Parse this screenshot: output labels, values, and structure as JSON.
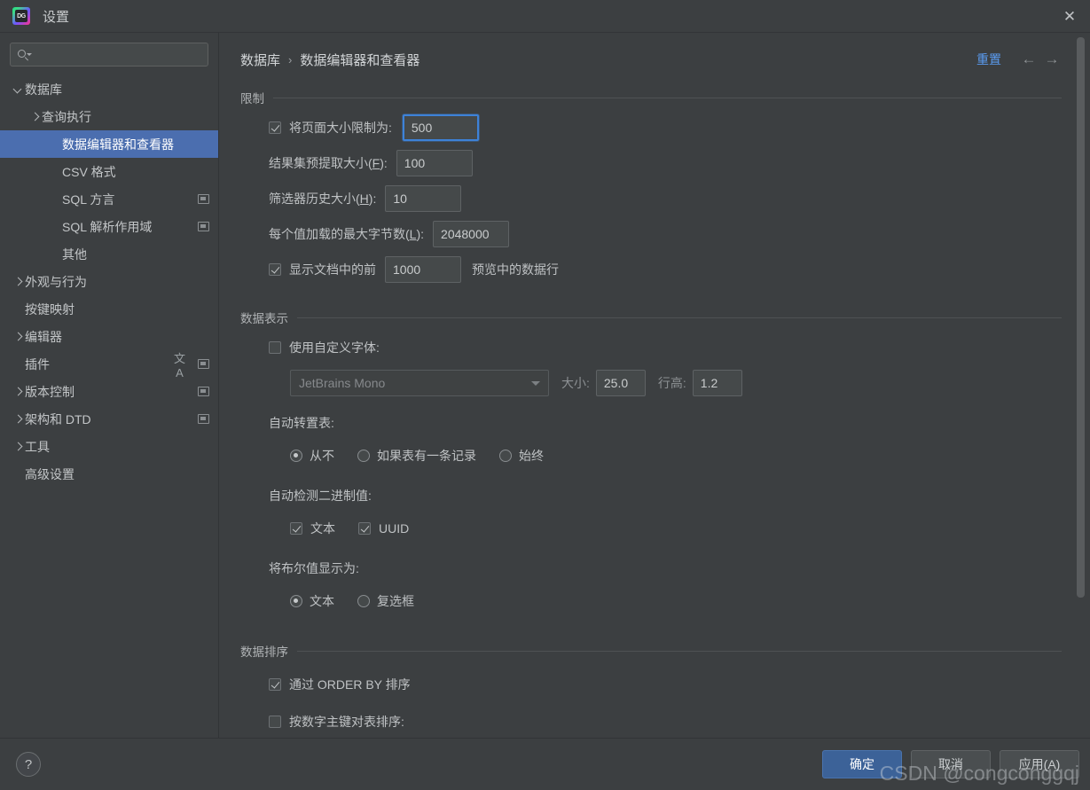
{
  "window": {
    "title": "设置",
    "app_icon": "datagrip-icon",
    "icon_text": "DG",
    "close_label": "✕"
  },
  "sidebar": {
    "search": {
      "placeholder": "",
      "value": "",
      "icon": "search-icon"
    },
    "items": [
      {
        "label": "数据库",
        "level": 0,
        "arrow": "down",
        "selected": false,
        "badge": false,
        "translate": false
      },
      {
        "label": "查询执行",
        "level": 1,
        "arrow": "right",
        "selected": false,
        "badge": false,
        "translate": false
      },
      {
        "label": "数据编辑器和查看器",
        "level": 2,
        "arrow": "none",
        "selected": true,
        "badge": false,
        "translate": false
      },
      {
        "label": "CSV 格式",
        "level": 2,
        "arrow": "none",
        "selected": false,
        "badge": false,
        "translate": false
      },
      {
        "label": "SQL 方言",
        "level": 2,
        "arrow": "none",
        "selected": false,
        "badge": true,
        "translate": false
      },
      {
        "label": "SQL 解析作用域",
        "level": 2,
        "arrow": "none",
        "selected": false,
        "badge": true,
        "translate": false
      },
      {
        "label": "其他",
        "level": 2,
        "arrow": "none",
        "selected": false,
        "badge": false,
        "translate": false
      },
      {
        "label": "外观与行为",
        "level": 0,
        "arrow": "right",
        "selected": false,
        "badge": false,
        "translate": false
      },
      {
        "label": "按键映射",
        "level": 0,
        "arrow": "none",
        "selected": false,
        "badge": false,
        "translate": false
      },
      {
        "label": "编辑器",
        "level": 0,
        "arrow": "right",
        "selected": false,
        "badge": false,
        "translate": false
      },
      {
        "label": "插件",
        "level": 0,
        "arrow": "none",
        "selected": false,
        "badge": true,
        "translate": true
      },
      {
        "label": "版本控制",
        "level": 0,
        "arrow": "right",
        "selected": false,
        "badge": true,
        "translate": false
      },
      {
        "label": "架构和 DTD",
        "level": 0,
        "arrow": "right",
        "selected": false,
        "badge": true,
        "translate": false
      },
      {
        "label": "工具",
        "level": 0,
        "arrow": "right",
        "selected": false,
        "badge": false,
        "translate": false
      },
      {
        "label": "高级设置",
        "level": 0,
        "arrow": "none",
        "selected": false,
        "badge": false,
        "translate": false
      }
    ]
  },
  "header": {
    "breadcrumb_root": "数据库",
    "breadcrumb_sep": "›",
    "breadcrumb_current": "数据编辑器和查看器",
    "reset_label": "重置",
    "back_icon": "←",
    "forward_icon": "→",
    "link_color": "#5a9bf0"
  },
  "limits": {
    "section_title": "限制",
    "page_size": {
      "label": "将页面大小限制为:",
      "checked": true,
      "value": "500",
      "focused": true
    },
    "fetch_size": {
      "label_pre": "结果集预提取大小(",
      "label_mnemonic": "F",
      "label_post": "):",
      "value": "100"
    },
    "filter_history": {
      "label_pre": "筛选器历史大小(",
      "label_mnemonic": "H",
      "label_post": "):",
      "value": "10"
    },
    "max_bytes": {
      "label_pre": "每个值加载的最大字节数(",
      "label_mnemonic": "L",
      "label_post": "):",
      "value": "2048000"
    },
    "doc_preview": {
      "checked": true,
      "label_pre": "显示文档中的前",
      "value": "1000",
      "label_post": "预览中的数据行"
    }
  },
  "display": {
    "section_title": "数据表示",
    "custom_font": {
      "label": "使用自定义字体:",
      "checked": false
    },
    "font_family": {
      "value": "JetBrains Mono",
      "disabled": true
    },
    "font_size": {
      "label": "大小:",
      "value": "25.0"
    },
    "line_height": {
      "label": "行高:",
      "value": "1.2"
    },
    "auto_transpose": {
      "label": "自动转置表:",
      "options": [
        {
          "label": "从不",
          "selected": true
        },
        {
          "label": "如果表有一条记录",
          "selected": false
        },
        {
          "label": "始终",
          "selected": false
        }
      ]
    },
    "detect_binary": {
      "label": "自动检测二进制值:",
      "options": [
        {
          "label": "文本",
          "checked": true
        },
        {
          "label": "UUID",
          "checked": true
        }
      ]
    },
    "boolean_display": {
      "label": "将布尔值显示为:",
      "options": [
        {
          "label": "文本",
          "selected": true
        },
        {
          "label": "复选框",
          "selected": false
        }
      ]
    }
  },
  "sorting": {
    "section_title": "数据排序",
    "order_by": {
      "label": "通过 ORDER BY 排序",
      "checked": true
    },
    "numeric_pk": {
      "label": "按数字主键对表排序:",
      "checked": false
    }
  },
  "footer": {
    "help_label": "?",
    "ok_label": "确定",
    "cancel_label": "取消",
    "apply_label": "应用(A)",
    "primary_color": "#3c6298"
  },
  "watermark": {
    "text": "CSDN @congconggqj"
  }
}
